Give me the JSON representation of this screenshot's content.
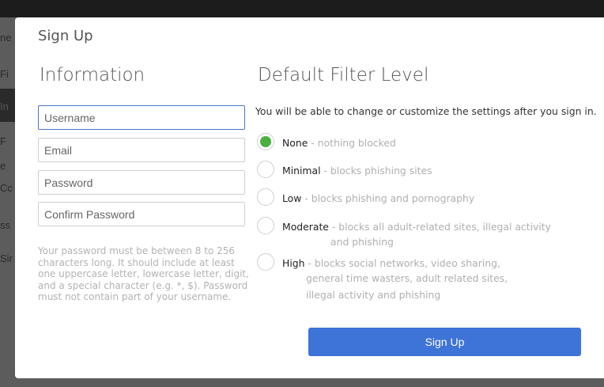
{
  "background": {
    "fragments": [
      "ne",
      "Fi",
      "In",
      "F",
      "e",
      "Cc",
      "ss",
      "Sir"
    ]
  },
  "modal": {
    "title": "Sign Up",
    "information_heading": "Information",
    "filter_heading": "Default Filter Level"
  },
  "form": {
    "username_placeholder": "Username",
    "email_placeholder": "Email",
    "password_placeholder": "Password",
    "confirm_placeholder": "Confirm Password",
    "password_help": "Your password must be between 8 to 256 characters long. It should include at least one uppercase letter, lowercase letter, digit, and a special character (e.g. *, $). Password must not contain part of your username."
  },
  "filter": {
    "intro": "You will be able to change or customize the settings after you sign in.",
    "selected": "None",
    "options": [
      {
        "name": "None",
        "desc": " - nothing blocked",
        "cont": []
      },
      {
        "name": "Minimal",
        "desc": " - blocks phishing sites",
        "cont": []
      },
      {
        "name": "Low",
        "desc": " - blocks phishing and pornography",
        "cont": []
      },
      {
        "name": "Moderate",
        "desc": " - blocks all adult-related sites, illegal activity",
        "cont": [
          "and phishing"
        ]
      },
      {
        "name": "High",
        "desc": " - blocks social networks, video sharing,",
        "cont": [
          "general time wasters, adult related sites,",
          "illegal activity and phishing"
        ]
      }
    ]
  },
  "submit_label": "Sign Up",
  "colors": {
    "accent": "#3e73d8",
    "radio_selected": "#4caf3f",
    "focus_border": "#4a76c9"
  }
}
